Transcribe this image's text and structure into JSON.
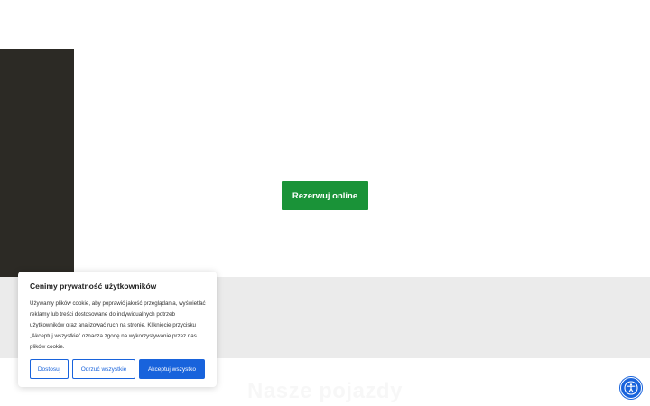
{
  "hero": {
    "cta_label": "Rezerwuj online"
  },
  "section": {
    "title": "Nasze pojazdy"
  },
  "cookie_banner": {
    "title": "Cenimy prywatność użytkowników",
    "text": "Używamy plików cookie, aby poprawić jakość przeglądania, wyświetlać reklamy lub treści dostosowane do indywidualnych potrzeb użytkowników oraz analizować ruch na stronie. Kliknięcie przycisku „Akceptuj wszystkie\" oznacza zgodę na wykorzystywanie przez nas plików cookie.",
    "customize_label": "Dostosuj",
    "reject_label": "Odrzuć wszystkie",
    "accept_label": "Akceptuj wszystko"
  },
  "colors": {
    "accent_green": "#1a9338",
    "side_panel": "#2c2a25",
    "cookie_blue": "#1863dc",
    "grey_band": "#ebebeb"
  },
  "icons": {
    "accessibility": "accessibility-icon"
  }
}
